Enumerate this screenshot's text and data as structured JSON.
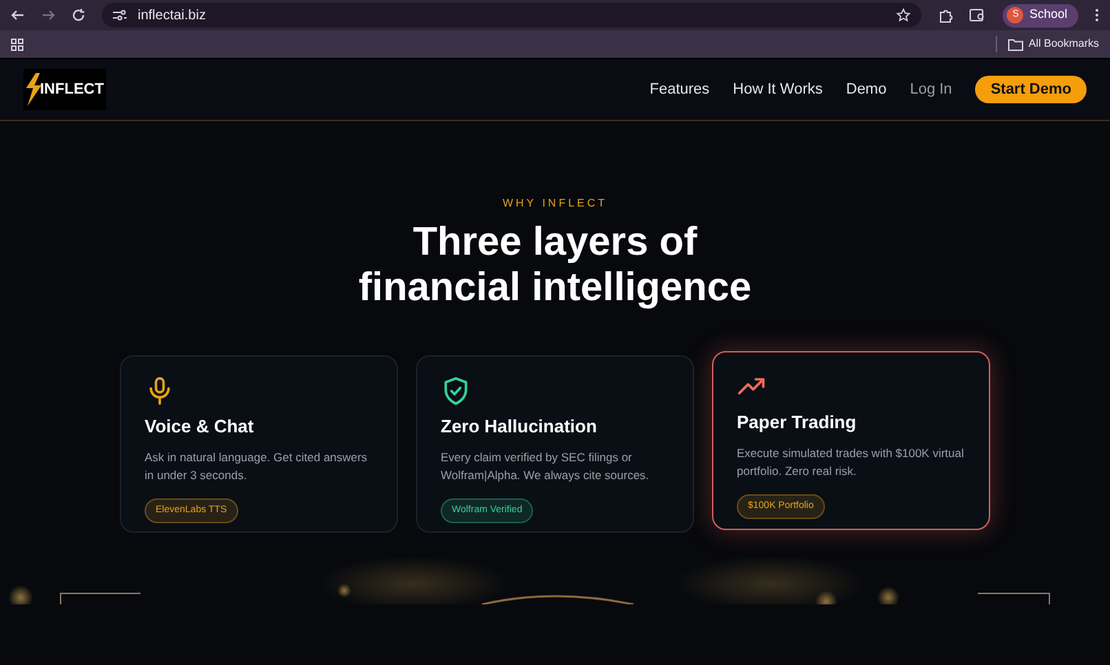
{
  "browser": {
    "url": "inflectai.biz",
    "profile_initial": "S",
    "profile_name": "School",
    "bookmarks_label": "All Bookmarks"
  },
  "nav": {
    "logo_text": "INFLECT",
    "links": [
      "Features",
      "How It Works",
      "Demo"
    ],
    "login": "Log In",
    "cta": "Start Demo"
  },
  "section": {
    "eyebrow": "WHY INFLECT",
    "heading_lines": [
      "Three layers of",
      "financial intelligence"
    ]
  },
  "cards": [
    {
      "kind": "voice",
      "title": "Voice & Chat",
      "text": "Ask in natural language. Get cited answers in under 3 seconds.",
      "tag": "ElevenLabs TTS",
      "color": "#e8a317",
      "highlighted": false
    },
    {
      "kind": "shield",
      "title": "Zero Hallucination",
      "text": "Every claim verified by SEC filings or Wolfram|Alpha. We always cite sources.",
      "tag": "Wolfram Verified",
      "color": "#34d399",
      "highlighted": false
    },
    {
      "kind": "trend",
      "title": "Paper Trading",
      "text": "Execute simulated trades with $100K virtual portfolio. Zero real risk.",
      "tag": "$100K Portfolio",
      "color": "#e8a317",
      "highlighted": true
    }
  ]
}
